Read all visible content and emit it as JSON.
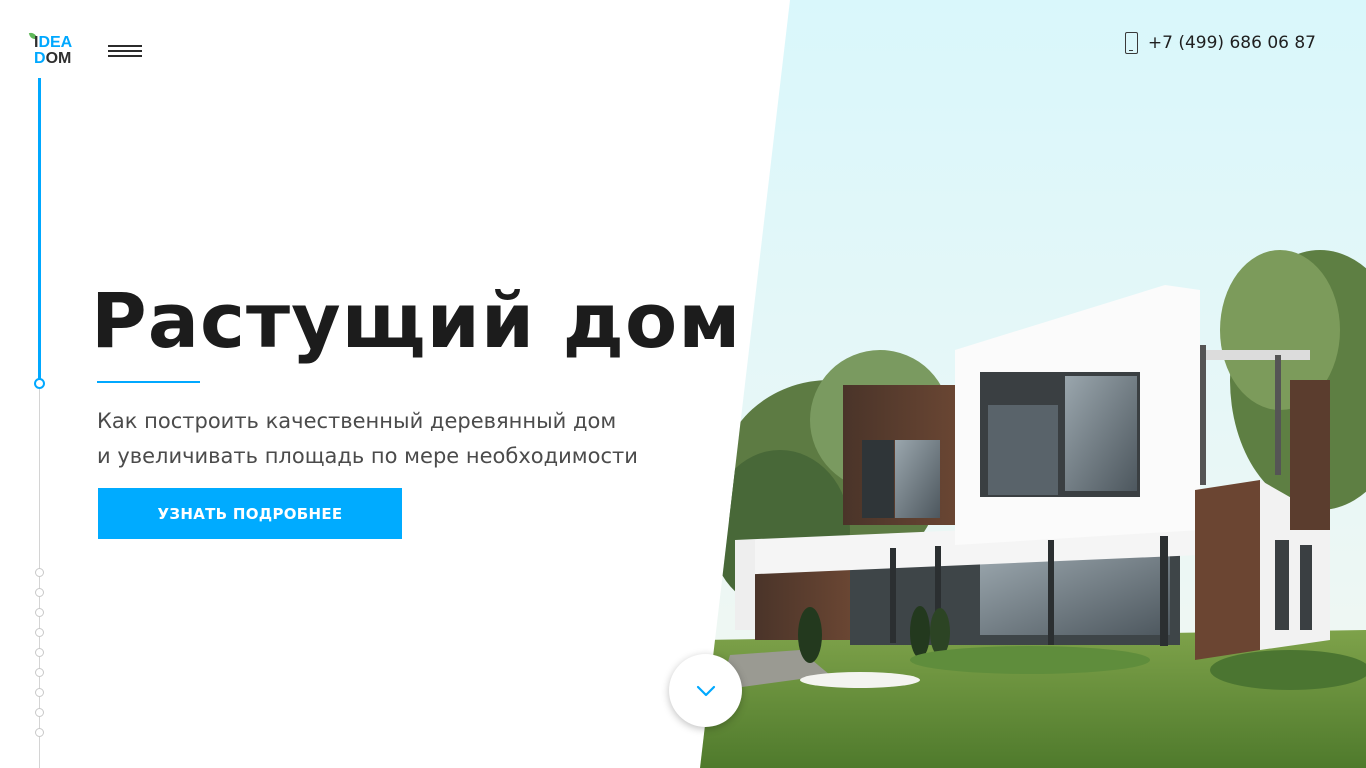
{
  "header": {
    "logo": {
      "line1_a": "I",
      "line1_b": "DEA",
      "line2_a": "D",
      "line2_b": "OM"
    },
    "phone": "+7 (499) 686 06 87"
  },
  "hero": {
    "title": "Растущий дом",
    "subtitle_line1": "Как построить качественный деревянный дом",
    "subtitle_line2": "и увеличивать площадь по мере необходимости",
    "cta_label": "УЗНАТЬ ПОДРОБНЕЕ"
  },
  "icons": {
    "menu": "hamburger-icon",
    "phone": "phone-icon",
    "scroll": "chevron-down-icon"
  },
  "colors": {
    "accent": "#00abff",
    "text_dark": "#1c1c1c",
    "text_muted": "#4b4b4b",
    "rail_inactive": "#d4d4d4"
  },
  "progress": {
    "sections_total": 10,
    "active_index": 0
  }
}
